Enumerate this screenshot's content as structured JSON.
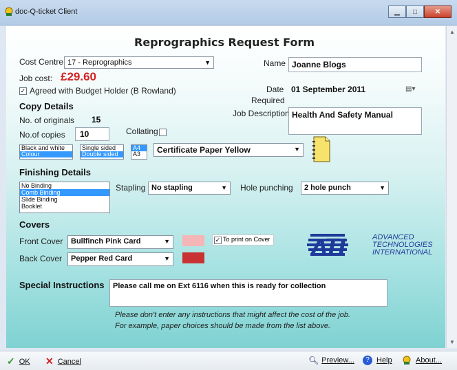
{
  "window": {
    "title": "doc-Q-ticket Client"
  },
  "form": {
    "title": "Reprographics Request Form",
    "cost_centre_label": "Cost Centre",
    "cost_centre_value": "17 - Reprographics",
    "job_cost_label": "Job cost:",
    "job_cost_value": "£29.60",
    "agreed_label": "Agreed with Budget Holder (B Rowland)",
    "name_label": "Name",
    "name_value": "Joanne Blogs",
    "date_label_1": "Date",
    "date_label_2": "Required",
    "date_value": "01 September 2011",
    "job_desc_label": "Job Description",
    "job_desc_value": "Health And Safety Manual",
    "copy_details_heading": "Copy Details",
    "originals_label": "No. of originals",
    "originals_value": "15",
    "copies_label": "No.of copies",
    "copies_value": "10",
    "collating_label": "Collating",
    "colour_options": [
      "Black and white",
      "Colour"
    ],
    "sides_options": [
      "Single sided",
      "Double sided"
    ],
    "paper_size_options": [
      "A4",
      "A3"
    ],
    "paper_type_value": "Certificate Paper Yellow",
    "finishing_heading": "Finishing Details",
    "binding_options": [
      "No Binding",
      "Comb Binding",
      "Slide Binding",
      "Booklet"
    ],
    "stapling_label": "Stapling",
    "stapling_value": "No stapling",
    "hole_label": "Hole punching",
    "hole_value": "2 hole punch",
    "covers_heading": "Covers",
    "front_cover_label": "Front Cover",
    "front_cover_value": "Bullfinch Pink Card",
    "print_on_cover_label": "To print on Cover",
    "back_cover_label": "Back Cover",
    "back_cover_value": "Pepper Red Card",
    "special_heading": "Special Instructions",
    "special_value": "Please call me on Ext 6116 when this is ready for collection",
    "note_line1": "Please don't enter any instructions that might affect the cost of the job.",
    "note_line2": "For example, paper choices should be made from the list above."
  },
  "logo": {
    "mark": "ATI",
    "line1": "ADVANCED",
    "line2": "TECHNOLOGIES",
    "line3": "INTERNATIONAL"
  },
  "colors": {
    "front_cover": "#f4b6b6",
    "back_cover": "#c83232",
    "job_cost": "#d42020",
    "accent_blue": "#1f3a9a"
  },
  "statusbar": {
    "ok": "OK",
    "cancel": "Cancel",
    "preview": "Preview...",
    "help": "Help",
    "about": "About..."
  }
}
